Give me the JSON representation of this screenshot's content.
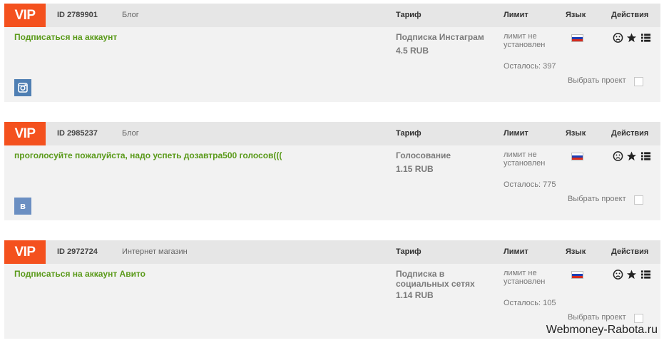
{
  "columns": {
    "tariff": "Тариф",
    "limit": "Лимит",
    "language": "Язык",
    "actions": "Действия"
  },
  "cards": [
    {
      "vip": "VIP",
      "id": "ID 2789901",
      "category": "Блог",
      "title": "Подписаться на аккаунт",
      "tariff_name": "Подписка Инстаграм",
      "tariff_price": "4.5 RUB",
      "limit": "лимит не установлен",
      "remaining": "Осталось: 397",
      "select_label": "Выбрать проект",
      "network": "instagram-icon"
    },
    {
      "vip": "VIP",
      "id": "ID 2985237",
      "category": "Блог",
      "title": "проголосуйте пожалуйста, надо успеть дозавтра500 голосов(((",
      "tariff_name": "Голосование",
      "tariff_price": "1.15 RUB",
      "limit": "лимит не установлен",
      "remaining": "Осталось: 775",
      "select_label": "Выбрать проект",
      "network": "vk-icon",
      "network_letter": "в"
    },
    {
      "vip": "VIP",
      "id": "ID 2972724",
      "category": "Интернет магазин",
      "title": "Подписаться на аккаунт Авито",
      "tariff_name": "Подписка в социальных сетях",
      "tariff_price": "1.14 RUB",
      "limit": "лимит не установлен",
      "remaining": "Осталось: 105",
      "select_label": "Выбрать проект"
    }
  ],
  "watermark": "Webmoney-Rabota.ru",
  "colors": {
    "vip": "#f4511e",
    "title": "#5a9a1a",
    "header": "#e6e6e6",
    "card": "#f2f2f2"
  }
}
